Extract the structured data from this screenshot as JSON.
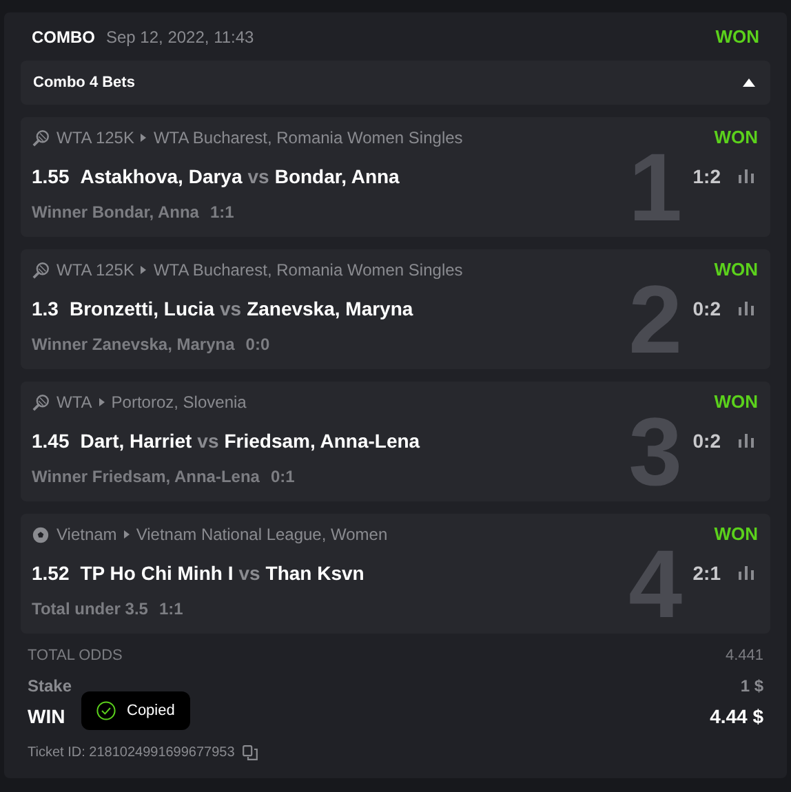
{
  "header": {
    "title": "COMBO",
    "date": "Sep 12, 2022, 11:43",
    "status": "WON"
  },
  "combo": {
    "label": "Combo 4 Bets",
    "expanded": true
  },
  "bets": [
    {
      "kind": "tennis",
      "category": "WTA 125K",
      "tournament": "WTA Bucharest, Romania Women Singles",
      "status": "WON",
      "odds": "1.55",
      "home": "Astakhova, Darya",
      "vs": "vs",
      "away": "Bondar, Anna",
      "score": "1:2",
      "market": "Winner Bondar, Anna",
      "market_score": "1:1",
      "number": "1"
    },
    {
      "kind": "tennis",
      "category": "WTA 125K",
      "tournament": "WTA Bucharest, Romania Women Singles",
      "status": "WON",
      "odds": "1.3",
      "home": "Bronzetti, Lucia",
      "vs": "vs",
      "away": "Zanevska, Maryna",
      "score": "0:2",
      "market": "Winner Zanevska, Maryna",
      "market_score": "0:0",
      "number": "2"
    },
    {
      "kind": "tennis",
      "category": "WTA",
      "tournament": "Portoroz, Slovenia",
      "status": "WON",
      "odds": "1.45",
      "home": "Dart, Harriet",
      "vs": "vs",
      "away": "Friedsam, Anna-Lena",
      "score": "0:2",
      "market": "Winner Friedsam, Anna-Lena",
      "market_score": "0:1",
      "number": "3"
    },
    {
      "kind": "soccer",
      "category": "Vietnam",
      "tournament": "Vietnam National League, Women",
      "status": "WON",
      "odds": "1.52",
      "home": "TP Ho Chi Minh I",
      "vs": "vs",
      "away": "Than Ksvn",
      "score": "2:1",
      "market": "Total under 3.5",
      "market_score": "1:1",
      "number": "4"
    }
  ],
  "summary": {
    "total_odds_label": "TOTAL ODDS",
    "total_odds": "4.441",
    "stake_label": "Stake",
    "stake": "1 $",
    "win_label": "WIN",
    "win": "4.44 $",
    "ticket": "Ticket ID: 2181024991699677953"
  },
  "toast": {
    "text": "Copied"
  }
}
